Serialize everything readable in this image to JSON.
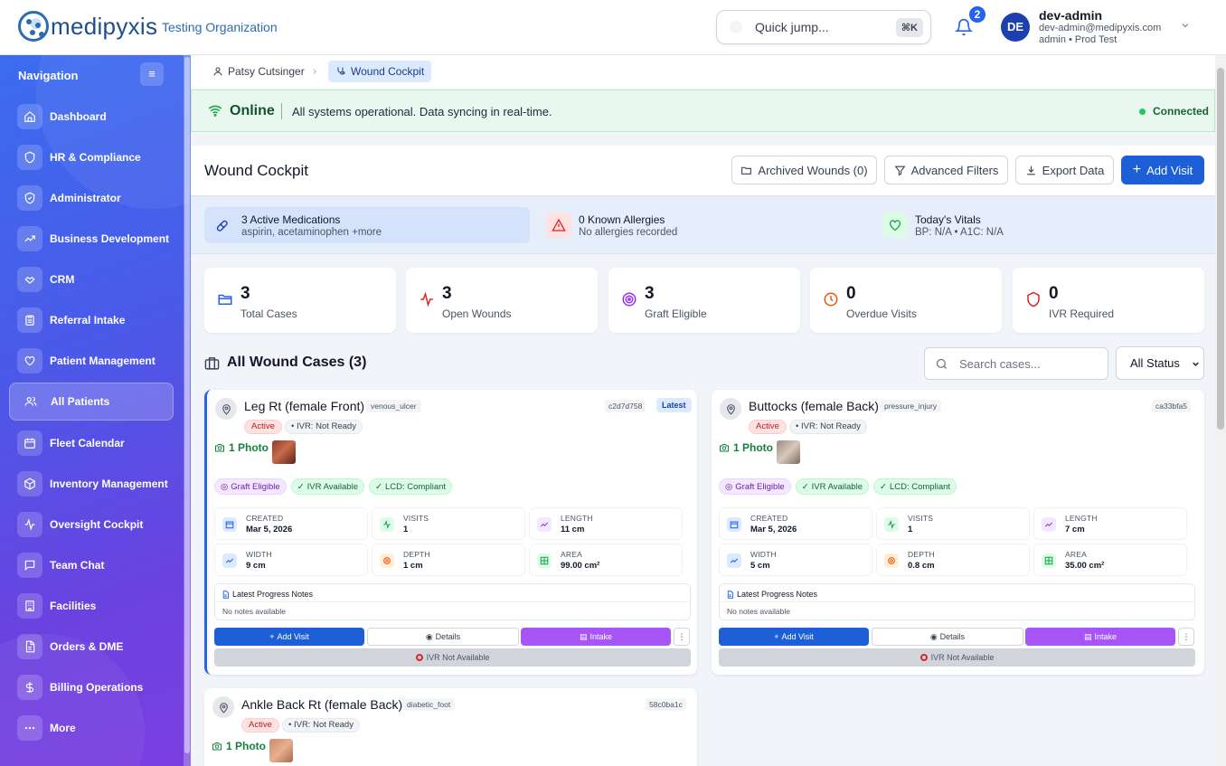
{
  "header": {
    "logo_text": "medipyxis",
    "org": "Testing Organization",
    "quick_jump": "Quick jump...",
    "quick_kbd": "⌘K",
    "notif_count": "2",
    "avatar_initials": "DE",
    "user_name": "dev-admin",
    "user_email": "dev-admin@medipyxis.com",
    "user_role": "admin • Prod Test"
  },
  "sidebar": {
    "title": "Navigation",
    "items": [
      {
        "label": "Dashboard",
        "icon": "home-icon"
      },
      {
        "label": "HR & Compliance",
        "icon": "shield-icon"
      },
      {
        "label": "Administrator",
        "icon": "shield-check-icon"
      },
      {
        "label": "Business Development",
        "icon": "trending-up-icon"
      },
      {
        "label": "CRM",
        "icon": "handshake-icon"
      },
      {
        "label": "Referral Intake",
        "icon": "clipboard-icon"
      },
      {
        "label": "Patient Management",
        "icon": "heart-icon"
      },
      {
        "label": "All Patients",
        "icon": "users-icon",
        "active": true
      },
      {
        "label": "Fleet Calendar",
        "icon": "calendar-icon"
      },
      {
        "label": "Inventory Management",
        "icon": "package-icon"
      },
      {
        "label": "Oversight Cockpit",
        "icon": "activity-icon"
      },
      {
        "label": "Team Chat",
        "icon": "message-icon"
      },
      {
        "label": "Facilities",
        "icon": "building-icon"
      },
      {
        "label": "Orders & DME",
        "icon": "file-icon"
      },
      {
        "label": "Billing Operations",
        "icon": "dollar-icon"
      },
      {
        "label": "More",
        "icon": "more-icon"
      }
    ]
  },
  "breadcrumb": {
    "patient": "Patsy Cutsinger",
    "current": "Wound Cockpit"
  },
  "status": {
    "state": "Online",
    "message": "All systems operational. Data syncing in real-time.",
    "connection": "Connected"
  },
  "page": {
    "title": "Wound Cockpit",
    "archived": "Archived Wounds (0)",
    "filters": "Advanced Filters",
    "export": "Export Data",
    "add_visit": "Add Visit"
  },
  "info": {
    "meds_title": "3 Active Medications",
    "meds_sub": "aspirin, acetaminophen +more",
    "allergy_title": "0 Known Allergies",
    "allergy_sub": "No allergies recorded",
    "vitals_title": "Today's Vitals",
    "vitals_sub": "BP: N/A • A1C: N/A"
  },
  "stats": [
    {
      "value": "3",
      "label": "Total Cases",
      "color": "#2563eb"
    },
    {
      "value": "3",
      "label": "Open Wounds",
      "color": "#dc2626"
    },
    {
      "value": "3",
      "label": "Graft Eligible",
      "color": "#9333ea"
    },
    {
      "value": "0",
      "label": "Overdue Visits",
      "color": "#ea580c"
    },
    {
      "value": "0",
      "label": "IVR Required",
      "color": "#dc2626"
    }
  ],
  "cases": {
    "title": "All Wound Cases (3)",
    "search_placeholder": "Search cases...",
    "status_filter": "All Status",
    "list": [
      {
        "title": "Leg Rt (female Front)",
        "type": "venous_ulcer",
        "id": "c2d7d758",
        "latest": "Latest",
        "status": "Active",
        "ivr": "IVR: Not Ready",
        "photos": "1 Photo",
        "badges": [
          "Graft Eligible",
          "IVR Available",
          "LCD: Compliant"
        ],
        "created_label": "CREATED",
        "created": "Mar 5, 2026",
        "visits_label": "VISITS",
        "visits": "1",
        "length_label": "LENGTH",
        "length": "11 cm",
        "width_label": "WIDTH",
        "width": "9 cm",
        "depth_label": "DEPTH",
        "depth": "1 cm",
        "area_label": "AREA",
        "area": "99.00 cm²",
        "notes_title": "Latest Progress Notes",
        "notes": "No notes available",
        "btn_add": "Add Visit",
        "btn_details": "Details",
        "btn_intake": "Intake",
        "btn_more": "⋮",
        "ivr_na": "IVR Not Available"
      },
      {
        "title": "Buttocks (female Back)",
        "type": "pressure_injury",
        "id": "ca33bfa5",
        "status": "Active",
        "ivr": "IVR: Not Ready",
        "photos": "1 Photo",
        "badges": [
          "Graft Eligible",
          "IVR Available",
          "LCD: Compliant"
        ],
        "created_label": "CREATED",
        "created": "Mar 5, 2026",
        "visits_label": "VISITS",
        "visits": "1",
        "length_label": "LENGTH",
        "length": "7 cm",
        "width_label": "WIDTH",
        "width": "5 cm",
        "depth_label": "DEPTH",
        "depth": "0.8 cm",
        "area_label": "AREA",
        "area": "35.00 cm²",
        "notes_title": "Latest Progress Notes",
        "notes": "No notes available",
        "btn_add": "Add Visit",
        "btn_details": "Details",
        "btn_intake": "Intake",
        "btn_more": "⋮",
        "ivr_na": "IVR Not Available"
      },
      {
        "title": "Ankle Back Rt (female Back)",
        "type": "diabetic_foot",
        "id": "58c0ba1c",
        "status": "Active",
        "ivr": "IVR: Not Ready",
        "photos": "1 Photo"
      }
    ]
  }
}
